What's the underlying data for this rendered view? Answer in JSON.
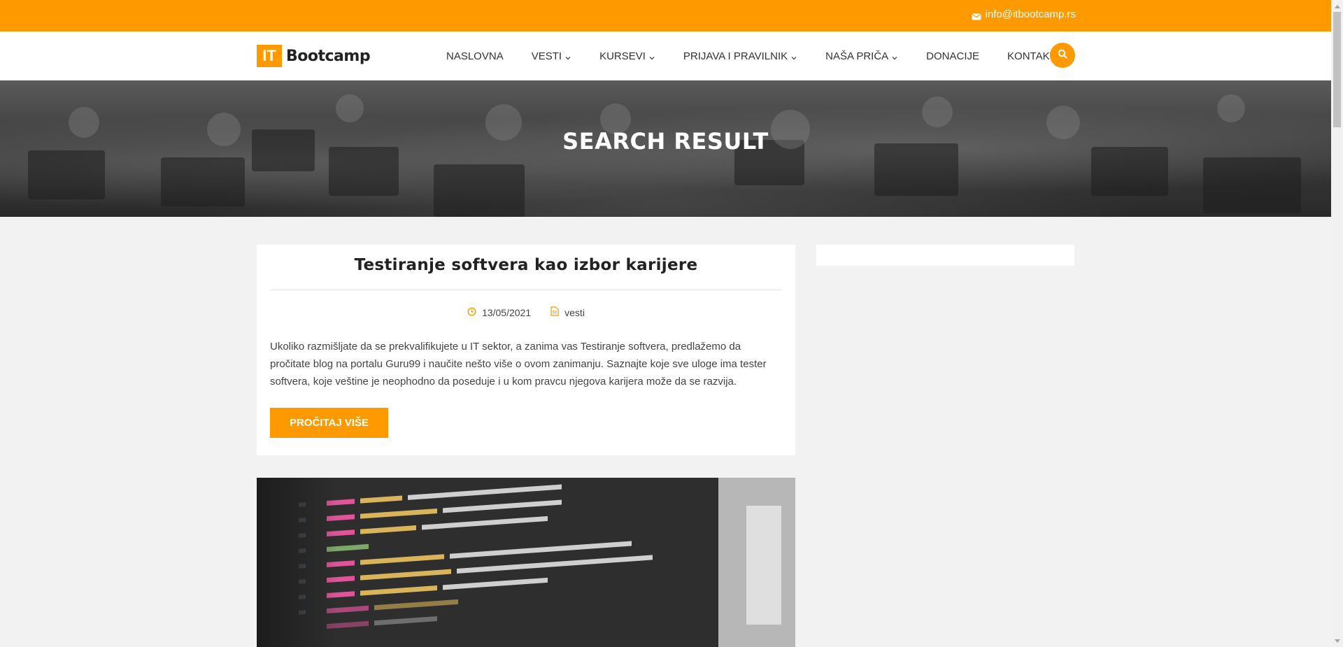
{
  "topbar": {
    "email": "info@itbootcamp.rs",
    "icon": "envelope-icon",
    "color": "#ff9900"
  },
  "logo": {
    "badge": "IT",
    "text": "Bootcamp"
  },
  "nav": {
    "items": [
      {
        "label": "NASLOVNA",
        "dropdown": false
      },
      {
        "label": "VESTI",
        "dropdown": true
      },
      {
        "label": "KURSEVI",
        "dropdown": true
      },
      {
        "label": "PRIJAVA I PRAVILNIK",
        "dropdown": true
      },
      {
        "label": "NAŠA PRIČA",
        "dropdown": true
      },
      {
        "label": "DONACIJE",
        "dropdown": false
      },
      {
        "label": "KONTAKT",
        "dropdown": false
      }
    ],
    "search_icon": "search-icon"
  },
  "hero": {
    "title": "SEARCH RESULT"
  },
  "post": {
    "title": "Testiranje softvera kao izbor karijere",
    "date": "13/05/2021",
    "category": "vesti",
    "excerpt": "Ukoliko razmišljate da se prekvalifikujete u IT sektor, a zanima vas Testiranje softvera, predlažemo da pročitate blog na portalu Guru99 i naučite nešto više o ovom zanimanju. Saznajte koje sve uloge ima tester softvera, koje veštine je neophodno da poseduje i u kom pravcu njegova karijera može da se razvija.",
    "read_more": "PROČITAJ VIŠE"
  },
  "accent_color": "#ff9900"
}
